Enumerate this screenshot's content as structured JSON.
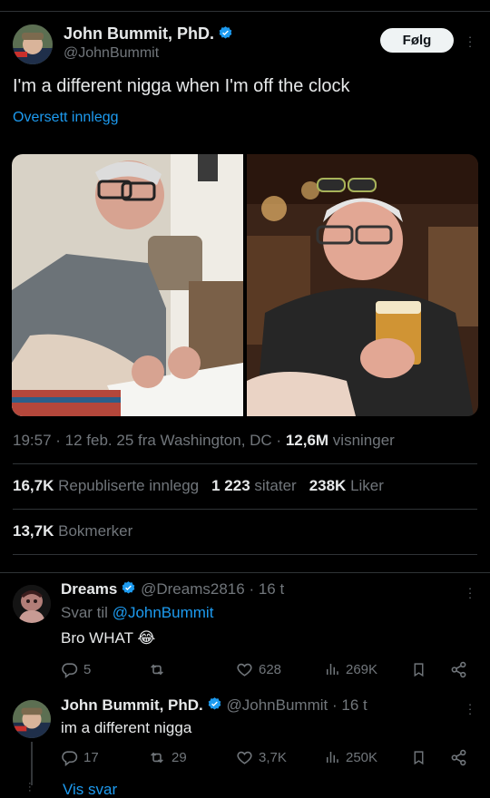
{
  "tweet": {
    "author_name": "John Bummit, PhD.",
    "handle": "@JohnBummit",
    "follow_label": "Følg",
    "text": "I'm a different nigga when I'm off the clock",
    "translate_label": "Oversett innlegg",
    "meta_time": "19:57 · 12 feb. 25 fra Washington, DC · ",
    "views_count": "12,6M",
    "views_label": " visninger",
    "reposts_count": "16,7K",
    "reposts_label": "Republiserte innlegg",
    "quotes_count": "1 223",
    "quotes_label": "sitater",
    "likes_count": "238K",
    "likes_label": "Liker",
    "bookmarks_count": "13,7K",
    "bookmarks_label": "Bokmerker"
  },
  "replies": [
    {
      "name": "Dreams",
      "handle": "@Dreams2816",
      "time": "· 16 t",
      "reply_to_prefix": "Svar til ",
      "reply_to_handle": "@JohnBummit",
      "text": "Bro WHAT 😂",
      "replies": "5",
      "reposts": "",
      "likes": "628",
      "views": "269K"
    },
    {
      "name": "John Bummit, PhD.",
      "handle": "@JohnBummit",
      "time": "· 16 t",
      "text": "im a different nigga",
      "replies": "17",
      "reposts": "29",
      "likes": "3,7K",
      "views": "250K",
      "show_replies": "Vis svar"
    }
  ],
  "icons": {
    "verified": "verified-badge-icon",
    "more": "more-dots-icon",
    "reply": "reply-icon",
    "repost": "repost-icon",
    "like": "heart-icon",
    "views": "views-icon",
    "bookmark": "bookmark-icon",
    "share": "share-icon"
  },
  "colors": {
    "accent": "#1d9bf0",
    "muted": "#71767b",
    "text": "#e7e9ea",
    "separator": "#2f3336"
  }
}
